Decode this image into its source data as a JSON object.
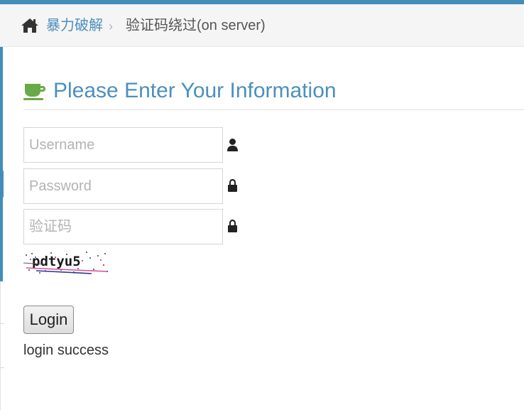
{
  "breadcrumbs": {
    "home_icon": "home-icon",
    "parent_label": "暴力破解",
    "separator": "›",
    "current_label": "验证码绕过(on server)"
  },
  "form": {
    "heading": "Please Enter Your Information",
    "heading_icon": "coffee-cup-icon",
    "username_placeholder": "Username",
    "password_placeholder": "Password",
    "captcha_input_placeholder": "验证码",
    "username_icon": "user-icon",
    "password_icon": "lock-icon",
    "captcha_icon": "lock-icon",
    "captcha_text": "pdtyu5",
    "login_label": "Login",
    "result_text": "login success"
  },
  "colors": {
    "accent": "#438eb9",
    "link": "#4c8fbd",
    "cup_icon": "#69aa46"
  }
}
